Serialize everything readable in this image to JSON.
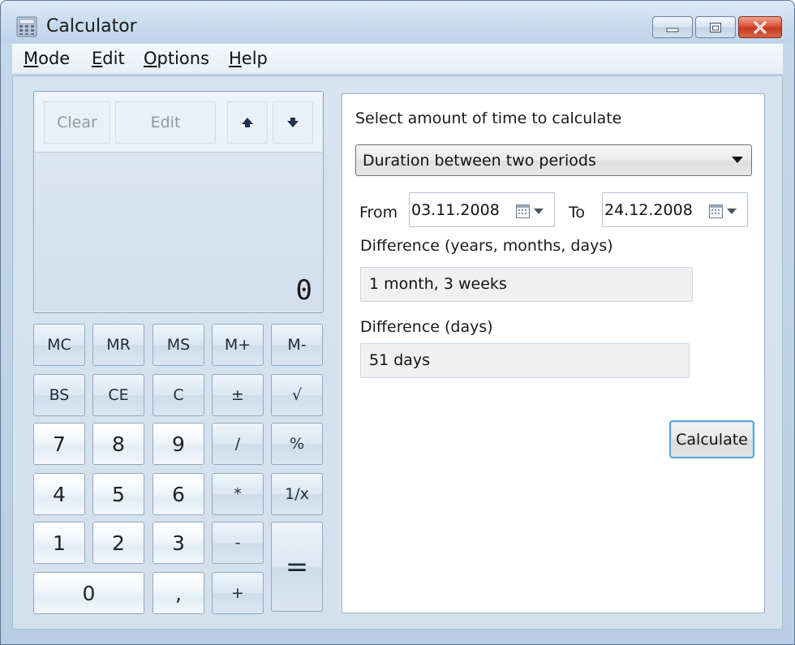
{
  "window": {
    "title": "Calculator"
  },
  "menu": [
    {
      "accel": "M",
      "rest": "ode"
    },
    {
      "accel": "E",
      "rest": "dit"
    },
    {
      "accel": "O",
      "rest": "ptions"
    },
    {
      "accel": "H",
      "rest": "elp"
    }
  ],
  "calc": {
    "history": {
      "clear_label": "Clear",
      "edit_label": "Edit",
      "up_icon": "arrow-up-icon",
      "down_icon": "arrow-down-icon"
    },
    "display_value": "0",
    "keys": [
      [
        "MC",
        "MR",
        "MS",
        "M+",
        "M-"
      ],
      [
        "BS",
        "CE",
        "C",
        "±",
        "√"
      ],
      [
        "7",
        "8",
        "9",
        "/",
        "%"
      ],
      [
        "4",
        "5",
        "6",
        "*",
        "1/x"
      ],
      [
        "1",
        "2",
        "3",
        "-",
        "="
      ],
      [
        "0",
        ",",
        "+"
      ]
    ]
  },
  "date_calc": {
    "heading": "Select amount of time to calculate",
    "mode_selected": "Duration between two periods",
    "from_label": "From",
    "from_value": "03.11.2008",
    "to_label": "To",
    "to_value": "24.12.2008",
    "diff_ymd_label": "Difference (years, months, days)",
    "diff_ymd_value": "1 month, 3 weeks",
    "diff_days_label": "Difference (days)",
    "diff_days_value": "51 days",
    "calculate_label": "Calculate"
  }
}
